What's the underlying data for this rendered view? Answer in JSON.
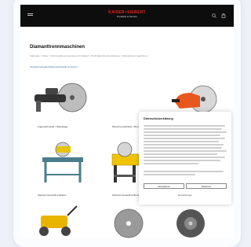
{
  "header": {
    "logo_title": "KAISER+SIEBERT",
    "logo_subtitle": "Produkte & Service",
    "menu_icon": "hamburger-icon",
    "search_icon": "search-icon",
    "cart_icon": "cart-icon"
  },
  "page": {
    "title": "Diamanttrennmaschinen",
    "breadcrumb": "Startseite > Shop > Profi-Gerätevermietung und Verkauf > Profi-Maschinenvermietung > Diamanttrennmaschinen",
    "link": "Vergleichsangebot/Mietpreis/Details anfordern"
  },
  "products": [
    {
      "caption": "Fugenschneider / Wandsäge",
      "color": "#444444"
    },
    {
      "caption": "Motortrennschleifer / Benzin",
      "color": "#e8571e"
    },
    {
      "caption": "Steintrennmaschine Elektro",
      "color": "#4a7d8c"
    },
    {
      "caption": "Steintrennmaschine Benzin",
      "color": "#f0c400"
    },
    {
      "caption": "",
      "color": "#e8b400"
    },
    {
      "caption": "",
      "color": "#777777"
    },
    {
      "caption": "",
      "color": "#555555"
    }
  ],
  "cookie": {
    "title": "Datenschutzerklärung",
    "accept_label": "Akzeptieren",
    "reject_label": "Ablehnen",
    "settings_label": "Einstellungen"
  },
  "colors": {
    "brand_red": "#e4221b",
    "header_bg": "#0d0d0d",
    "link_blue": "#2f6db3"
  }
}
